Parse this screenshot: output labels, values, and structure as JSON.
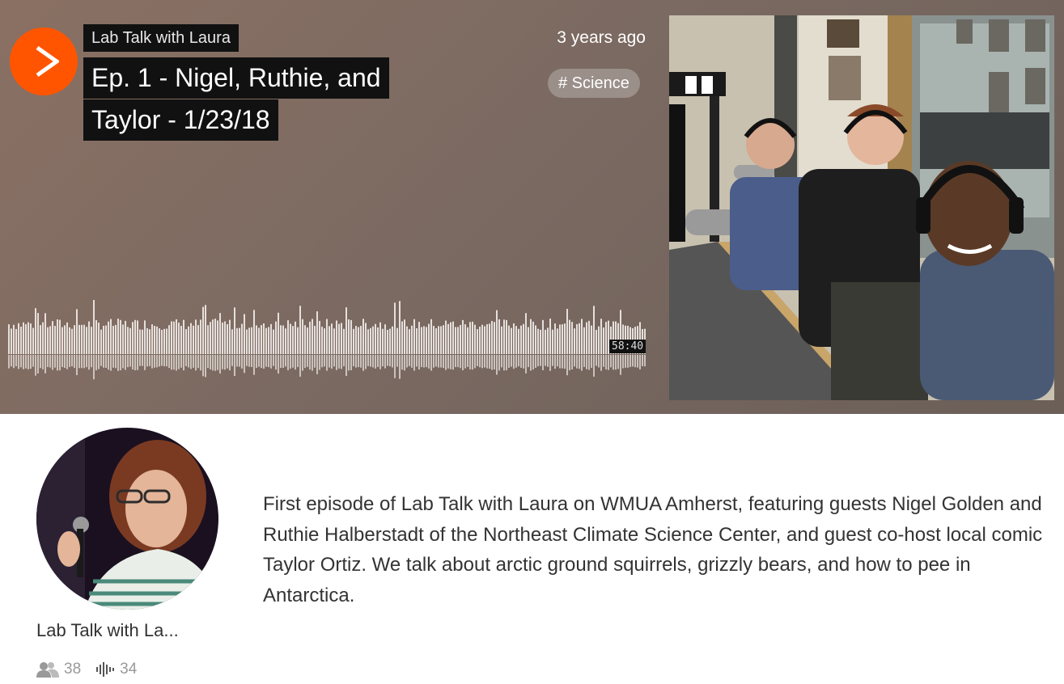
{
  "track": {
    "artist": "Lab Talk with Laura",
    "title_line1": "Ep. 1 - Nigel, Ruthie, and",
    "title_line2": "Taylor - 1/23/18",
    "posted": "3 years ago",
    "tag": "# Science",
    "duration": "58:40",
    "play_icon": "play-icon"
  },
  "user": {
    "name": "Lab Talk with La...",
    "followers": "38",
    "tracks": "34",
    "followers_icon": "followers-icon",
    "tracks_icon": "tracks-icon"
  },
  "description": "First episode of Lab Talk with Laura on WMUA Amherst, featuring guests Nigel Golden and Ruthie Halberstadt of the Northeast Climate Science Center, and guest co-host local comic Taylor Ortiz. We talk about arctic ground squirrels, grizzly bears, and how to pee in Antarctica.",
  "colors": {
    "accent": "#ff5500",
    "hero_bg": "#7b6a62",
    "waveform": "#e6e0dc",
    "text": "#333333",
    "muted": "#999999"
  }
}
